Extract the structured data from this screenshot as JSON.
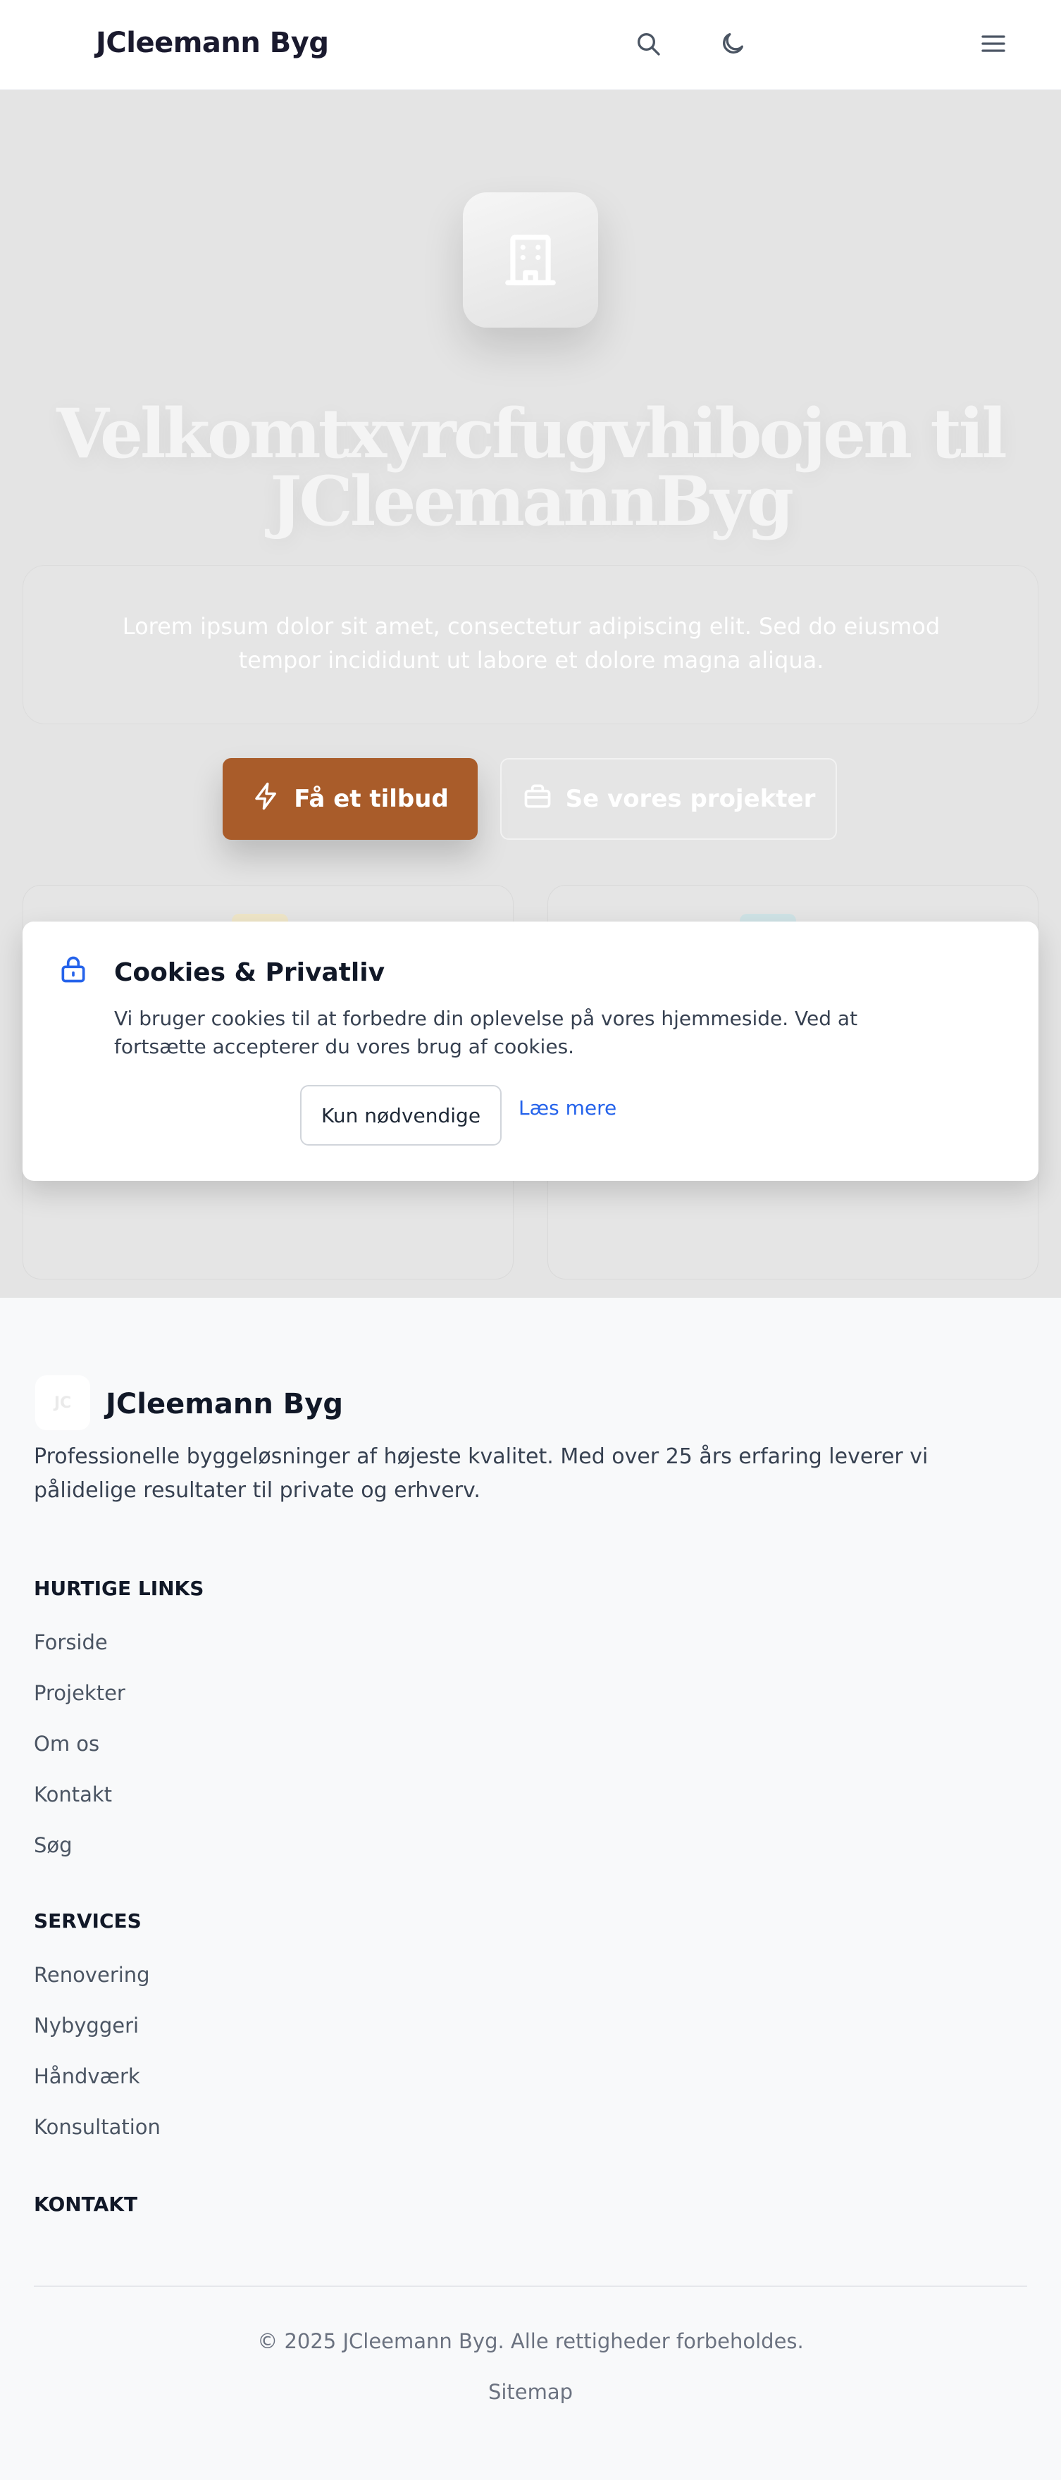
{
  "header": {
    "brand": "JCleemann Byg",
    "search_icon": "search-icon",
    "theme_icon": "moon-icon",
    "menu_icon": "menu-icon"
  },
  "hero": {
    "icon": "building-icon",
    "title": "Velkomtxyrcfugvhibojen til JCleemannByg",
    "subtitle": "Lorem ipsum dolor sit amet, consectetur adipiscing elit. Sed do eiusmod tempor incididunt ut labore et dolore magna aliqua.",
    "primary_button": "Få et tilbud",
    "primary_icon": "bolt-icon",
    "secondary_button": "Se vores projekter",
    "secondary_icon": "briefcase-icon"
  },
  "cookie": {
    "icon": "lock-icon",
    "title": "Cookies & Privatliv",
    "text": "Vi bruger cookies til at forbedre din oplevelse på vores hjemmeside. Ved at fortsætte accepterer du vores brug af cookies.",
    "necessary_button": "Kun nødvendige",
    "read_more": "Læs mere"
  },
  "footer": {
    "logo_text": "JC",
    "brand": "JCleemann Byg",
    "description": "Professionelle byggeløsninger af højeste kvalitet. Med over 25 års erfaring leverer vi pålidelige resultater til private og erhverv.",
    "quick_links_heading": "HURTIGE LINKS",
    "quick_links": [
      "Forside",
      "Projekter",
      "Om os",
      "Kontakt",
      "Søg"
    ],
    "services_heading": "SERVICES",
    "services": [
      "Renovering",
      "Nybyggeri",
      "Håndværk",
      "Konsultation"
    ],
    "contact_heading": "KONTAKT",
    "copyright": "© 2025 JCleemann Byg. Alle rettigheder forbeholdes.",
    "sitemap": "Sitemap"
  },
  "colors": {
    "accent": "#a95c2a",
    "link": "#2563eb",
    "hero_bg": "#e4e4e4"
  }
}
